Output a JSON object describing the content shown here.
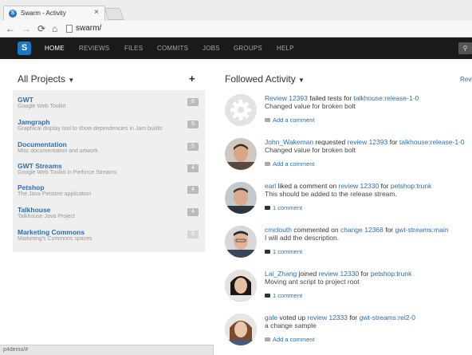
{
  "browser": {
    "tab_title": "Swarm - Activity",
    "tab_close": "×",
    "url": "swarm/"
  },
  "navbar": {
    "logo": "S",
    "items": [
      "HOME",
      "REVIEWS",
      "FILES",
      "COMMITS",
      "JOBS",
      "GROUPS",
      "HELP"
    ],
    "active": "HOME"
  },
  "projects": {
    "title": "All Projects",
    "add_symbol": "+",
    "items": [
      {
        "name": "GWT",
        "description": "Google Web Toolkit",
        "count": "8"
      },
      {
        "name": "Jamgraph",
        "description": "Graphical display tool to show dependencies in Jam builds",
        "count": "5"
      },
      {
        "name": "Documentation",
        "description": "Misc documentation and artwork",
        "count": "5"
      },
      {
        "name": "GWT Streams",
        "description": "Google Web Toolkit in Perforce Streams",
        "count": "4"
      },
      {
        "name": "Petshop",
        "description": "The Java Petstore application",
        "count": "4"
      },
      {
        "name": "Talkhouse",
        "description": "Talkhouse Java Project",
        "count": "4"
      },
      {
        "name": "Marketing Commons",
        "description": "Marketing's Commons spaces",
        "count": "3"
      }
    ]
  },
  "activity": {
    "title": "Followed Activity",
    "right_link": "Revi",
    "entries": [
      {
        "user": "",
        "pre": "",
        "link1": "Review 12393",
        "verb": " failed tests for ",
        "link2": "talkhouse:release-1-0",
        "message": "Changed value for broken bolt",
        "comment": "Add a comment"
      },
      {
        "user": "John_Wakeman",
        "pre": " requested ",
        "link1": "review 12393",
        "verb": " for ",
        "link2": "talkhouse:release-1-0",
        "message": "Changed value for broken bolt",
        "comment": "Add a comment"
      },
      {
        "user": "earl",
        "pre": " liked a comment on ",
        "link1": "review 12330",
        "verb": " for ",
        "link2": "petshop:trunk",
        "message": "This should be added to the release stream.",
        "comment": "1 comment"
      },
      {
        "user": "cmclouth",
        "pre": " commented on ",
        "link1": "change 12368",
        "verb": " for ",
        "link2": "gwt-streams:main",
        "message": "I will add the description.",
        "comment": "1 comment"
      },
      {
        "user": "Lai_Zhang",
        "pre": " joined ",
        "link1": "review 12330",
        "verb": " for ",
        "link2": "petshop:trunk",
        "message": "Moving ant script to project root",
        "comment": "1 comment"
      },
      {
        "user": "gale",
        "pre": " voted up ",
        "link1": "review 12333",
        "verb": " for ",
        "link2": "gwt-streams:rel2-0",
        "message": "a change sample",
        "comment": "Add a comment"
      }
    ]
  },
  "statusbar": {
    "text": "p4demo/#"
  }
}
